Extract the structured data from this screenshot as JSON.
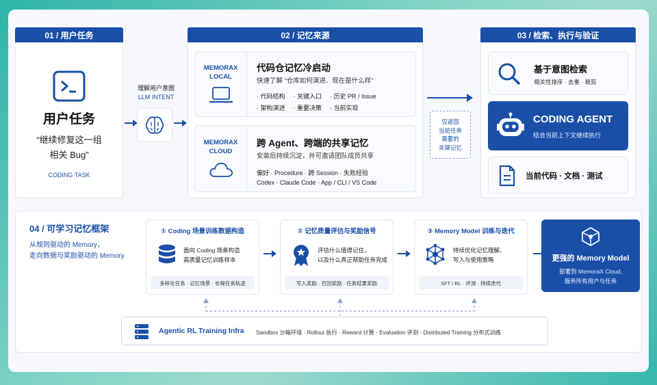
{
  "sec1": {
    "header": "01 / 用户任务",
    "title": "用户任务",
    "quote_line1": "“继续修复这一组",
    "quote_line2": "相关 Bug”",
    "tag": "CODING TASK"
  },
  "intent": {
    "line1": "理解用户意图",
    "line2": "LLM INTENT"
  },
  "sec2": {
    "header": "02 / 记忆来源",
    "local": {
      "label1": "MEMORAX",
      "label2": "LOCAL",
      "title": "代码仓记忆冷启动",
      "subtitle": "快速了解 “仓库如何演进、现在是什么样”",
      "bullets_row1": [
        "代码结构",
        "关键入口",
        "历史 PR / Issue"
      ],
      "bullets_row2": [
        "架构演进",
        "重要决策",
        "当前实现"
      ]
    },
    "cloud": {
      "label1": "MEMORAX",
      "label2": "CLOUD",
      "title": "跨 Agent、跨端的共享记忆",
      "subtitle": "安装后持续沉淀，并可邀请团队成员共享",
      "row1": "偏好 · Procedure · 跨 Session · 失败经验",
      "row2": "Codex · Claude Code · App / CLI / VS Code"
    }
  },
  "return_note": [
    "仅返回",
    "当前任务",
    "需要的",
    "关键记忆"
  ],
  "sec3": {
    "header": "03 / 检索、执行与验证",
    "search": {
      "title": "基于意图检索",
      "sub": "相关性排序 · 去重 · 裁剪"
    },
    "agent": {
      "title": "CODING AGENT",
      "sub": "结合当前上下文继续执行"
    },
    "docs": {
      "title": "当前代码 · 文档 · 测试"
    }
  },
  "sec4": {
    "title": "04 / 可学习记忆框架",
    "desc1": "从规则驱动的 Memory，",
    "desc2": "走向数据与奖励驱动的 Memory",
    "step1": {
      "title": "① Coding 场景训练数据构造",
      "desc1": "面向 Coding 场景构造",
      "desc2": "高质量记忆训练样本",
      "tags": "多样化任务 · 记忆场景 · 长程任务轨迹"
    },
    "step2": {
      "title": "② 记忆质量评估与奖励信号",
      "desc1": "评估什么值得记住，",
      "desc2": "以及什么真正帮助任务完成",
      "tags": "写入奖励 · 召回奖励 · 任务结果奖励"
    },
    "step3": {
      "title": "③ Memory Model 训练与迭代",
      "desc1": "持续优化记忆理解、",
      "desc2": "写入与使用策略",
      "tags": "SFT / RL · 评测 · 持续迭代"
    },
    "model": {
      "title": "更强的 Memory Model",
      "sub1": "部署到 MemoraX Cloud,",
      "sub2": "服务所有用户与任务"
    },
    "infra": {
      "title": "Agentic RL Training Infra",
      "items": "Sandbox 沙箱环境 · Rollout 执行 · Reward 计算 · Evaluation 评测 · Distributed Training 分布式训练"
    }
  },
  "colors": {
    "primary": "#1a4fa8",
    "bg": "#f6f8fc"
  }
}
